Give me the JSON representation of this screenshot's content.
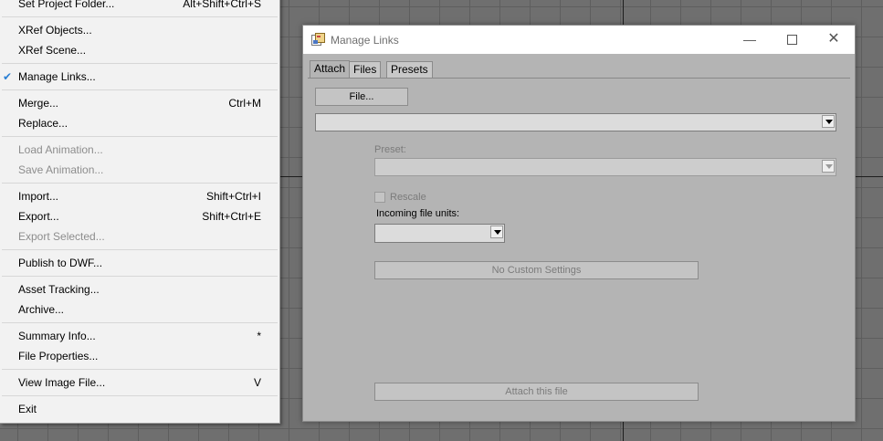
{
  "menu": {
    "groups": [
      [
        {
          "label": "Set Project Folder...",
          "shortcut": "Alt+Shift+Ctrl+S",
          "disabled": false
        }
      ],
      [
        {
          "label": "XRef Objects...",
          "shortcut": "",
          "disabled": false
        },
        {
          "label": "XRef Scene...",
          "shortcut": "",
          "disabled": false
        }
      ],
      [
        {
          "label": "Manage Links...",
          "shortcut": "",
          "disabled": false,
          "checked": true
        }
      ],
      [
        {
          "label": "Merge...",
          "shortcut": "Ctrl+M",
          "disabled": false
        },
        {
          "label": "Replace...",
          "shortcut": "",
          "disabled": false
        }
      ],
      [
        {
          "label": "Load Animation...",
          "shortcut": "",
          "disabled": true
        },
        {
          "label": "Save Animation...",
          "shortcut": "",
          "disabled": true
        }
      ],
      [
        {
          "label": "Import...",
          "shortcut": "Shift+Ctrl+I",
          "disabled": false
        },
        {
          "label": "Export...",
          "shortcut": "Shift+Ctrl+E",
          "disabled": false
        },
        {
          "label": "Export Selected...",
          "shortcut": "",
          "disabled": true
        }
      ],
      [
        {
          "label": "Publish to DWF...",
          "shortcut": "",
          "disabled": false
        }
      ],
      [
        {
          "label": "Asset Tracking...",
          "shortcut": "",
          "disabled": false
        },
        {
          "label": "Archive...",
          "shortcut": "",
          "disabled": false
        }
      ],
      [
        {
          "label": "Summary Info...",
          "shortcut": "*",
          "disabled": false
        },
        {
          "label": "File Properties...",
          "shortcut": "",
          "disabled": false
        }
      ],
      [
        {
          "label": "View Image File...",
          "shortcut": "V",
          "disabled": false
        }
      ],
      [
        {
          "label": "Exit",
          "shortcut": "",
          "disabled": false
        }
      ]
    ]
  },
  "dialog": {
    "title": "Manage Links",
    "tabs": [
      "Attach",
      "Files",
      "Presets"
    ],
    "active_tab": "Attach",
    "file_button": "File...",
    "file_combo_value": "",
    "preset_label": "Preset:",
    "preset_value": "",
    "rescale_label": "Rescale",
    "rescale_checked": false,
    "units_label": "Incoming file units:",
    "units_value": "",
    "custom_settings_button": "No Custom Settings",
    "attach_button": "Attach this file"
  },
  "icons": {
    "window_icon": "manage-links-icon",
    "minimize": "minimize-icon",
    "maximize": "maximize-icon",
    "close": "close-icon",
    "check": "checkmark-icon",
    "dropdown": "chevron-down-icon"
  },
  "colors": {
    "menu_bg": "#f2f2f2",
    "dialog_bg": "#b4b4b4",
    "viewport_bg": "#6f6f6f",
    "check_accent": "#2a7fd4"
  }
}
